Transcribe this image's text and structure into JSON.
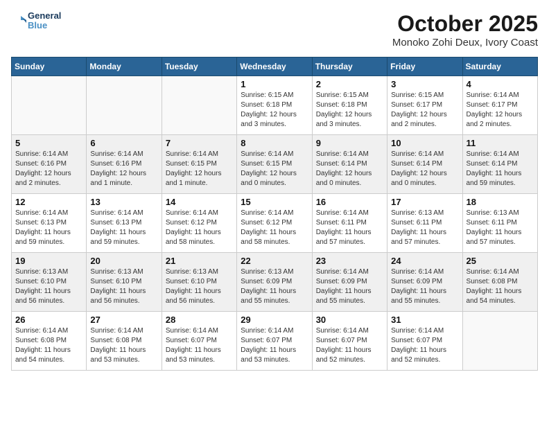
{
  "header": {
    "logo_line1": "General",
    "logo_line2": "Blue",
    "month": "October 2025",
    "location": "Monoko Zohi Deux, Ivory Coast"
  },
  "weekdays": [
    "Sunday",
    "Monday",
    "Tuesday",
    "Wednesday",
    "Thursday",
    "Friday",
    "Saturday"
  ],
  "weeks": [
    [
      {
        "day": "",
        "text": ""
      },
      {
        "day": "",
        "text": ""
      },
      {
        "day": "",
        "text": ""
      },
      {
        "day": "1",
        "text": "Sunrise: 6:15 AM\nSunset: 6:18 PM\nDaylight: 12 hours and 3 minutes."
      },
      {
        "day": "2",
        "text": "Sunrise: 6:15 AM\nSunset: 6:18 PM\nDaylight: 12 hours and 3 minutes."
      },
      {
        "day": "3",
        "text": "Sunrise: 6:15 AM\nSunset: 6:17 PM\nDaylight: 12 hours and 2 minutes."
      },
      {
        "day": "4",
        "text": "Sunrise: 6:14 AM\nSunset: 6:17 PM\nDaylight: 12 hours and 2 minutes."
      }
    ],
    [
      {
        "day": "5",
        "text": "Sunrise: 6:14 AM\nSunset: 6:16 PM\nDaylight: 12 hours and 2 minutes."
      },
      {
        "day": "6",
        "text": "Sunrise: 6:14 AM\nSunset: 6:16 PM\nDaylight: 12 hours and 1 minute."
      },
      {
        "day": "7",
        "text": "Sunrise: 6:14 AM\nSunset: 6:15 PM\nDaylight: 12 hours and 1 minute."
      },
      {
        "day": "8",
        "text": "Sunrise: 6:14 AM\nSunset: 6:15 PM\nDaylight: 12 hours and 0 minutes."
      },
      {
        "day": "9",
        "text": "Sunrise: 6:14 AM\nSunset: 6:14 PM\nDaylight: 12 hours and 0 minutes."
      },
      {
        "day": "10",
        "text": "Sunrise: 6:14 AM\nSunset: 6:14 PM\nDaylight: 12 hours and 0 minutes."
      },
      {
        "day": "11",
        "text": "Sunrise: 6:14 AM\nSunset: 6:14 PM\nDaylight: 11 hours and 59 minutes."
      }
    ],
    [
      {
        "day": "12",
        "text": "Sunrise: 6:14 AM\nSunset: 6:13 PM\nDaylight: 11 hours and 59 minutes."
      },
      {
        "day": "13",
        "text": "Sunrise: 6:14 AM\nSunset: 6:13 PM\nDaylight: 11 hours and 59 minutes."
      },
      {
        "day": "14",
        "text": "Sunrise: 6:14 AM\nSunset: 6:12 PM\nDaylight: 11 hours and 58 minutes."
      },
      {
        "day": "15",
        "text": "Sunrise: 6:14 AM\nSunset: 6:12 PM\nDaylight: 11 hours and 58 minutes."
      },
      {
        "day": "16",
        "text": "Sunrise: 6:14 AM\nSunset: 6:11 PM\nDaylight: 11 hours and 57 minutes."
      },
      {
        "day": "17",
        "text": "Sunrise: 6:13 AM\nSunset: 6:11 PM\nDaylight: 11 hours and 57 minutes."
      },
      {
        "day": "18",
        "text": "Sunrise: 6:13 AM\nSunset: 6:11 PM\nDaylight: 11 hours and 57 minutes."
      }
    ],
    [
      {
        "day": "19",
        "text": "Sunrise: 6:13 AM\nSunset: 6:10 PM\nDaylight: 11 hours and 56 minutes."
      },
      {
        "day": "20",
        "text": "Sunrise: 6:13 AM\nSunset: 6:10 PM\nDaylight: 11 hours and 56 minutes."
      },
      {
        "day": "21",
        "text": "Sunrise: 6:13 AM\nSunset: 6:10 PM\nDaylight: 11 hours and 56 minutes."
      },
      {
        "day": "22",
        "text": "Sunrise: 6:13 AM\nSunset: 6:09 PM\nDaylight: 11 hours and 55 minutes."
      },
      {
        "day": "23",
        "text": "Sunrise: 6:14 AM\nSunset: 6:09 PM\nDaylight: 11 hours and 55 minutes."
      },
      {
        "day": "24",
        "text": "Sunrise: 6:14 AM\nSunset: 6:09 PM\nDaylight: 11 hours and 55 minutes."
      },
      {
        "day": "25",
        "text": "Sunrise: 6:14 AM\nSunset: 6:08 PM\nDaylight: 11 hours and 54 minutes."
      }
    ],
    [
      {
        "day": "26",
        "text": "Sunrise: 6:14 AM\nSunset: 6:08 PM\nDaylight: 11 hours and 54 minutes."
      },
      {
        "day": "27",
        "text": "Sunrise: 6:14 AM\nSunset: 6:08 PM\nDaylight: 11 hours and 53 minutes."
      },
      {
        "day": "28",
        "text": "Sunrise: 6:14 AM\nSunset: 6:07 PM\nDaylight: 11 hours and 53 minutes."
      },
      {
        "day": "29",
        "text": "Sunrise: 6:14 AM\nSunset: 6:07 PM\nDaylight: 11 hours and 53 minutes."
      },
      {
        "day": "30",
        "text": "Sunrise: 6:14 AM\nSunset: 6:07 PM\nDaylight: 11 hours and 52 minutes."
      },
      {
        "day": "31",
        "text": "Sunrise: 6:14 AM\nSunset: 6:07 PM\nDaylight: 11 hours and 52 minutes."
      },
      {
        "day": "",
        "text": ""
      }
    ]
  ]
}
